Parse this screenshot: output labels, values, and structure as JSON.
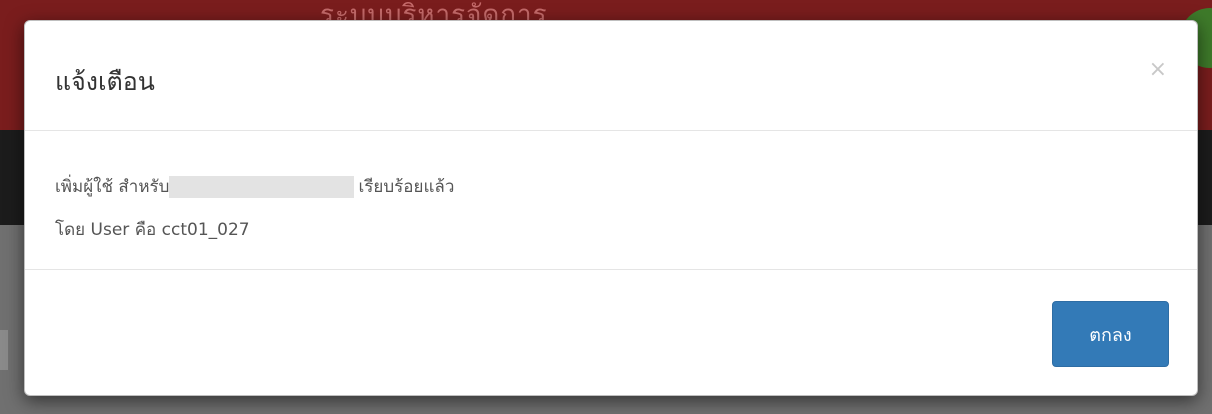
{
  "dialog": {
    "title": "แจ้งเตือน",
    "close_glyph": "×",
    "message_line1_prefix": "เพิ่มผู้ใช้ สำหรับ",
    "message_line1_suffix": "เรียบร้อยแล้ว",
    "message_line2": "โดย User คือ cct01_027",
    "ok_label": "ตกลง"
  },
  "colors": {
    "primary_button": "#337ab7",
    "header_background": "#7a1d1d",
    "navbar_background": "#1c1c1c"
  }
}
